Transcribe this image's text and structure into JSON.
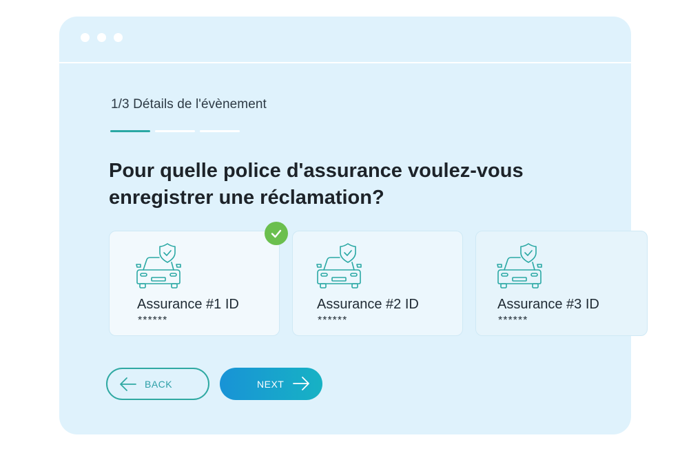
{
  "step": {
    "label": "1/3 Détails de l'évènement",
    "current": 1,
    "total": 3
  },
  "question": "Pour quelle police d'assurance voulez-vous enregistrer une réclamation?",
  "policies": [
    {
      "title": "Assurance #1 ID",
      "mask": "******",
      "selected": true,
      "icon": "car-shield-icon"
    },
    {
      "title": "Assurance #2 ID",
      "mask": "******",
      "selected": false,
      "icon": "car-shield-icon"
    },
    {
      "title": "Assurance #3 ID",
      "mask": "******",
      "selected": false,
      "icon": "car-shield-icon"
    }
  ],
  "buttons": {
    "back": "BACK",
    "next": "NEXT"
  },
  "colors": {
    "accent": "#2aa8a4",
    "next_gradient_start": "#1893d6",
    "next_gradient_end": "#17b2c4",
    "check": "#6bbf4e",
    "panel": "#dff2fc"
  }
}
